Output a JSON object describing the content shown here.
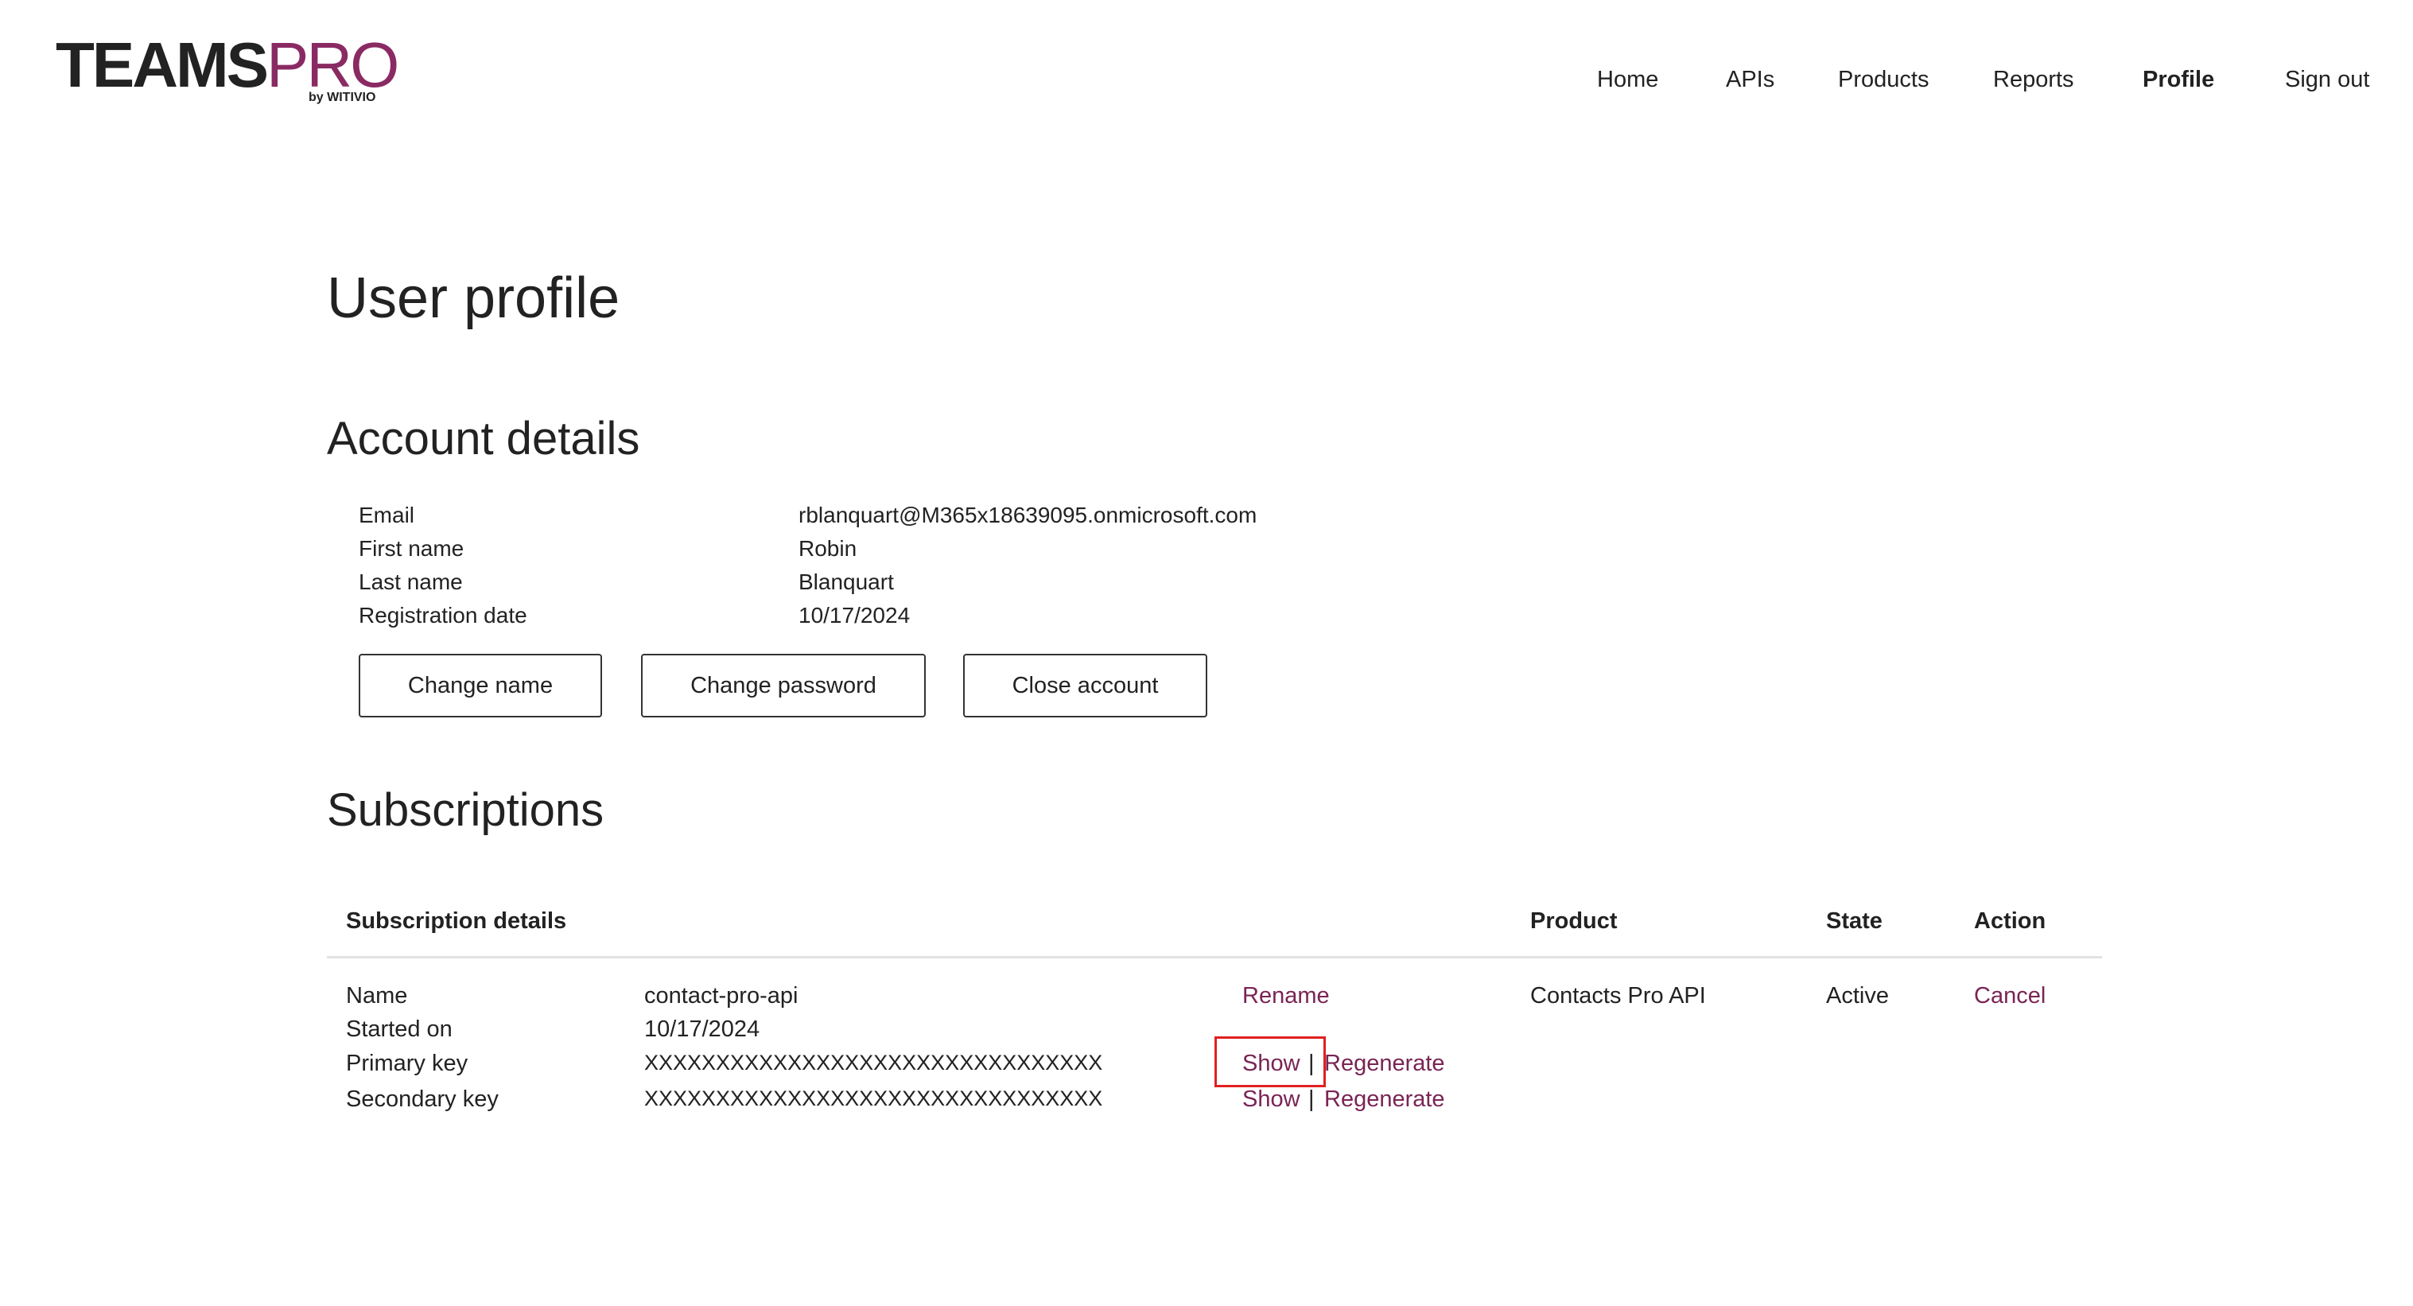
{
  "brand": {
    "name_main": "TEAMS",
    "name_accent": "PRO",
    "byline": "by WITIVIO",
    "accent_color": "#8a2a63"
  },
  "nav": {
    "items": [
      {
        "label": "Home"
      },
      {
        "label": "APIs"
      },
      {
        "label": "Products"
      },
      {
        "label": "Reports"
      },
      {
        "label": "Profile",
        "active": true
      },
      {
        "label": "Sign out"
      }
    ]
  },
  "page": {
    "title": "User profile"
  },
  "account": {
    "heading": "Account details",
    "fields": [
      {
        "label": "Email",
        "value": "rblanquart@M365x18639095.onmicrosoft.com"
      },
      {
        "label": "First name",
        "value": "Robin"
      },
      {
        "label": "Last name",
        "value": "Blanquart"
      },
      {
        "label": "Registration date",
        "value": "10/17/2024"
      }
    ],
    "buttons": {
      "change_name": "Change name",
      "change_password": "Change password",
      "close_account": "Close account"
    }
  },
  "subscriptions": {
    "heading": "Subscriptions",
    "columns": {
      "details": "Subscription details",
      "product": "Product",
      "state": "State",
      "action": "Action"
    },
    "row": {
      "name_label": "Name",
      "name_value": "contact-pro-api",
      "rename": "Rename",
      "started_label": "Started on",
      "started_value": "10/17/2024",
      "primary_label": "Primary key",
      "primary_value": "XXXXXXXXXXXXXXXXXXXXXXXXXXXXXXXX",
      "secondary_label": "Secondary key",
      "secondary_value": "XXXXXXXXXXXXXXXXXXXXXXXXXXXXXXXX",
      "show": "Show",
      "separator": "|",
      "regenerate": "Regenerate",
      "product": "Contacts Pro API",
      "state": "Active",
      "action": "Cancel"
    }
  }
}
